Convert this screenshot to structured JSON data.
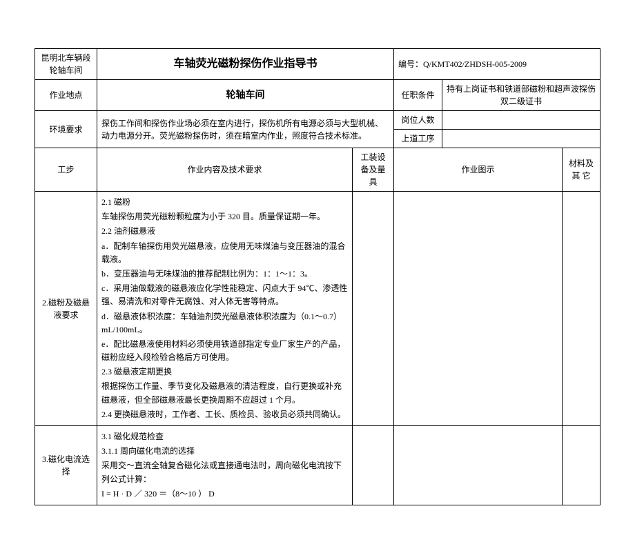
{
  "header": {
    "org_line1": "昆明北车辆段",
    "org_line2": "轮轴车间",
    "title": "车轴荧光磁粉探伤作业指导书",
    "doc_no_label": "编号：",
    "doc_no": "Q/KMT402/ZHDSH-005-2009"
  },
  "meta": {
    "location_label": "作业地点",
    "location_value": "轮轴车间",
    "qualification_label": "任职条件",
    "qualification_value": "持有上岗证书和铁道部磁粉和超声波探伤双二级证书",
    "env_label": "环境要求",
    "env_value": "探伤工作间和探伤作业场必须在室内进行，探伤机所有电源必须与大型机械、动力电源分开。荧光磁粉探伤时，须在暗室内作业，照度符合技术标准。",
    "post_count_label": "岗位人数",
    "post_count_value": "",
    "prev_process_label": "上道工序",
    "prev_process_value": ""
  },
  "columns": {
    "step": "工步",
    "content": "作业内容及技术要求",
    "tooling": "工装设备及量具",
    "illustration": "作业图示",
    "material": "材料及其  它"
  },
  "rows": [
    {
      "step": "2.磁粉及磁悬液要求",
      "lines": [
        "2.1 磁粉",
        "车轴探伤用荧光磁粉颗粒度为小于 320 目。质量保证期一年。",
        "2.2 油剂磁悬液",
        "a．配制车轴探伤用荧光磁悬液，应使用无味煤油与变压器油的混合载液。",
        "b．变压器油与无味煤油的推荐配制比例为：1：1～1：3。",
        "c．采用油做载液的磁悬液应化学性能稳定、闪点大于 94℃、渗透性强、易清洗和对零件无腐蚀、对人体无害等特点。",
        "d．磁悬液体积浓度：车轴油剂荧光磁悬液体积浓度为（0.1～0.7）mL/100mL。",
        "e．配比磁悬液使用材料必须使用铁道部指定专业厂家生产的产品，磁粉应经入段检验合格后方可使用。",
        "2.3 磁悬液定期更换",
        "根据探伤工作量、季节变化及磁悬液的清洁程度，自行更换或补充磁悬液，但全部磁悬液最长更换周期不应超过 1 个月。",
        "2.4 更换磁悬液时，工作者、工长、质检员、验收员必须共同确认。"
      ]
    },
    {
      "step": "3.磁化电流选择",
      "lines": [
        "3.1  磁化规范检查",
        "3.1.1 周向磁化电流的选择",
        "采用交～直流全轴复合磁化法或直接通电法时，周向磁化电流按下列公式计算：",
        "    I = H · D ／ 320 ＝（8～10 ） D"
      ]
    }
  ]
}
